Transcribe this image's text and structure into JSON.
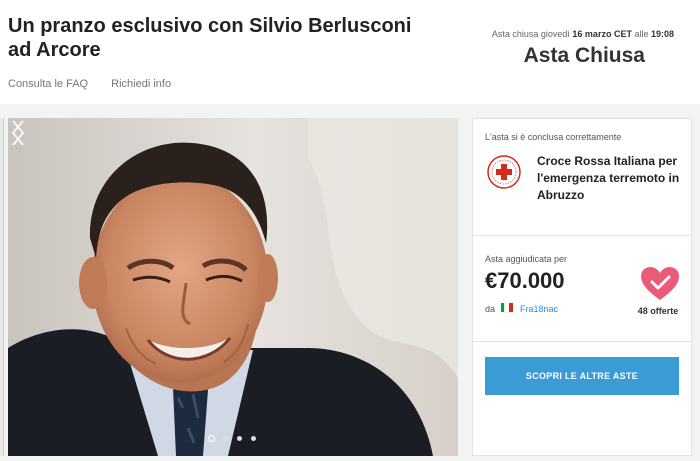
{
  "header": {
    "title": "Un pranzo esclusivo con Silvio Berlusconi ad Arcore",
    "links": {
      "faq": "Consulta le FAQ",
      "info": "Richiedi info"
    },
    "closed_prefix": "Asta chiusa giovedì ",
    "closed_date": "16 marzo CET",
    "closed_mid": " alle ",
    "closed_time": "19:08",
    "status": "Asta Chiusa"
  },
  "carousel": {
    "slide_count": 4,
    "active_index": 0
  },
  "side": {
    "concluded_note": "L'asta si è conclusa correttamente",
    "charity_name": "Croce Rossa Italiana per l'emergenza terremoto in Abruzzo",
    "awarded_label": "Asta aggiudicata per",
    "price": "€70.000",
    "by_label": "da",
    "winner": "Fra18nac",
    "offers": "48 offerte",
    "cta": "SCOPRI LE ALTRE ASTE"
  },
  "colors": {
    "accent": "#3a9bd5",
    "heart": "#ec5a7a",
    "red_cross": "#d52b1e",
    "link": "#2a8fd6"
  },
  "icons": [
    "chevron-left-icon",
    "chevron-right-icon",
    "heart-icon",
    "red-cross-logo",
    "italy-flag-icon"
  ]
}
